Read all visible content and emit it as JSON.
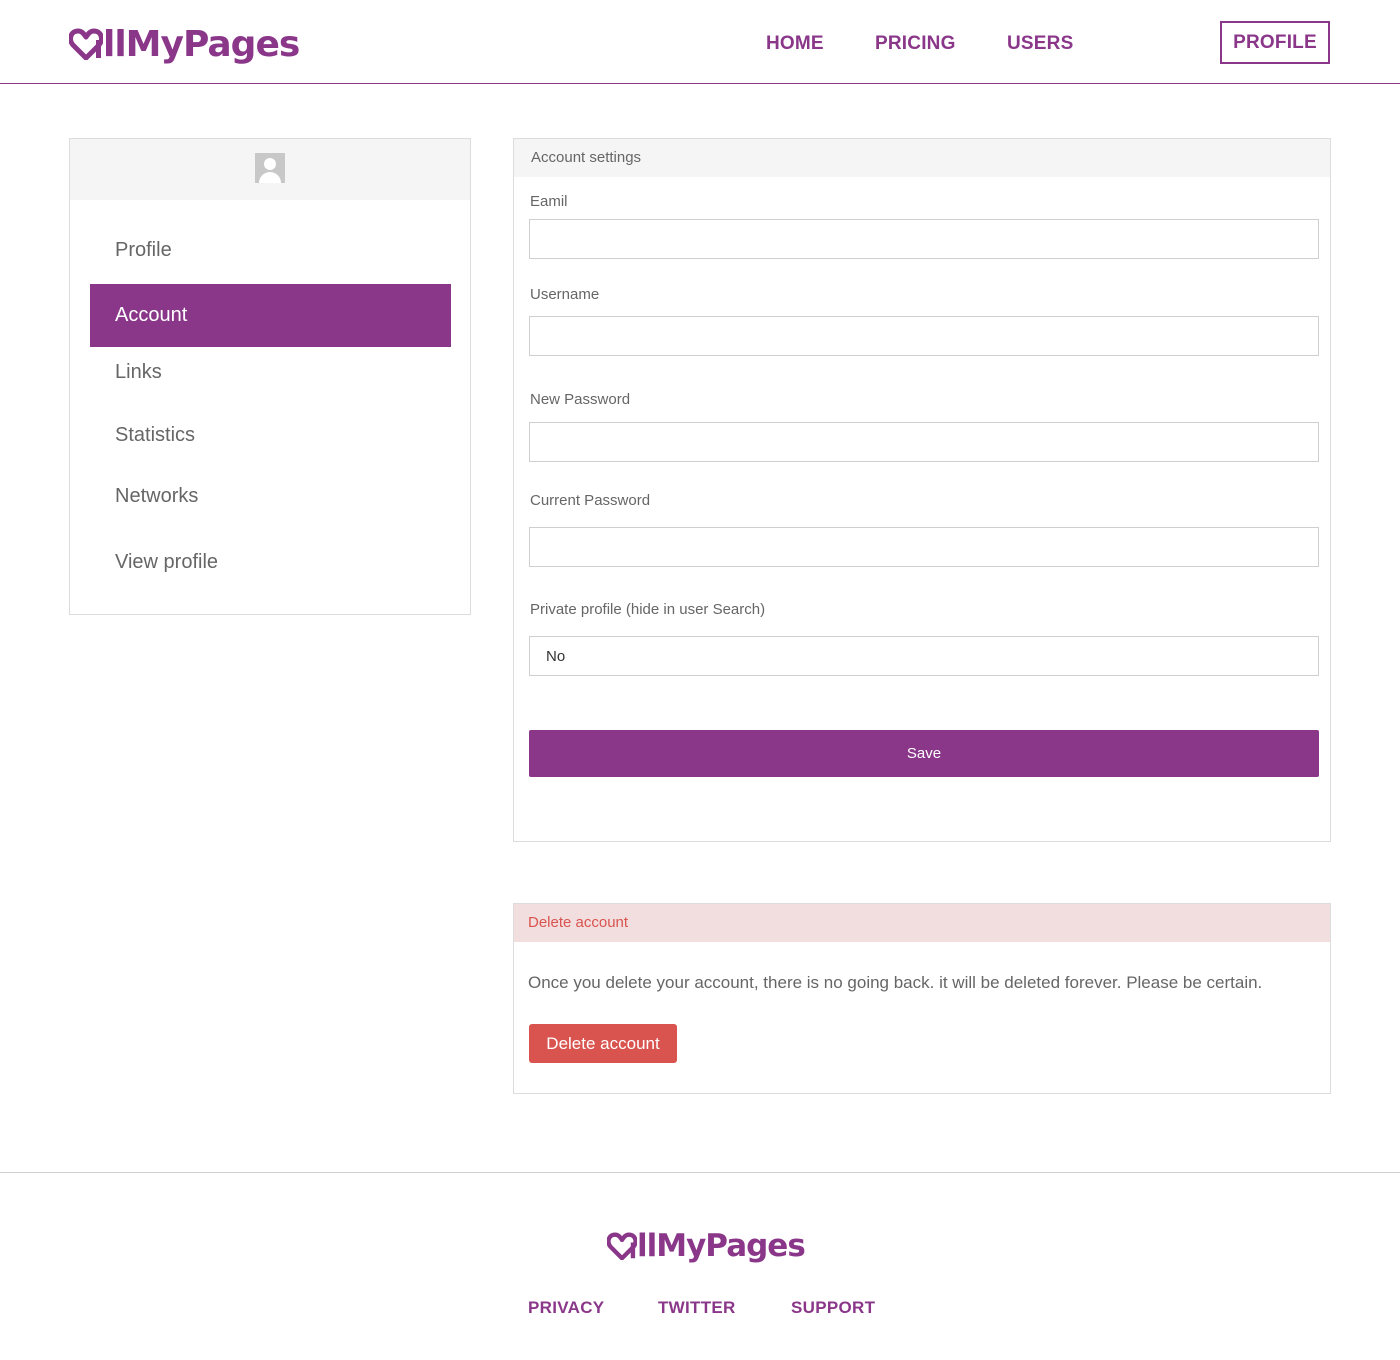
{
  "brand": {
    "name": "llMyPages",
    "accent_color": "#8a378a"
  },
  "nav": {
    "home": "HOME",
    "pricing": "PRICING",
    "users": "USERS",
    "profile": "PROFILE"
  },
  "sidebar": {
    "items": [
      {
        "label": "Profile",
        "active": false
      },
      {
        "label": "Account",
        "active": true
      },
      {
        "label": "Links",
        "active": false
      },
      {
        "label": "Statistics",
        "active": false
      },
      {
        "label": "Networks",
        "active": false
      },
      {
        "label": "View profile",
        "active": false
      }
    ]
  },
  "account_settings": {
    "title": "Account settings",
    "email_label": "Eamil",
    "email_value": "",
    "username_label": "Username",
    "username_value": "",
    "new_password_label": "New Password",
    "new_password_value": "",
    "current_password_label": "Current Password",
    "current_password_value": "",
    "private_label": "Private profile (hide in user Search)",
    "private_value": "No",
    "save_label": "Save"
  },
  "delete_account": {
    "title": "Delete account",
    "description": "Once you delete your account, there is no going back. it will be deleted forever. Please be certain.",
    "button_label": "Delete account",
    "danger_color": "#d9534f"
  },
  "footer": {
    "links": [
      "PRIVACY",
      "TWITTER",
      "SUPPORT"
    ]
  }
}
